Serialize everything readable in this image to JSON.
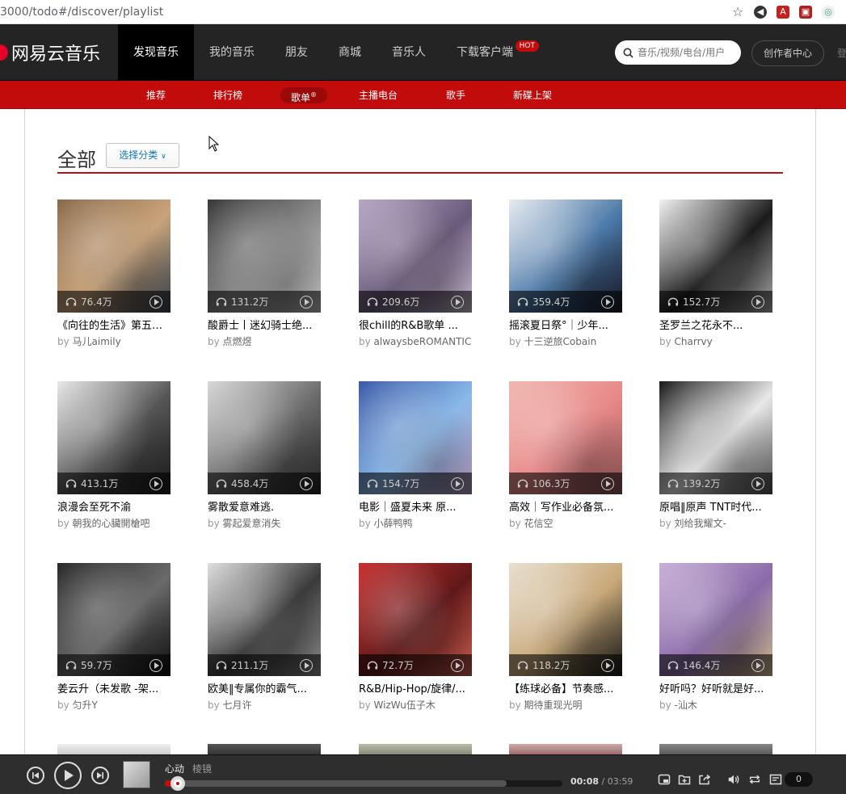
{
  "browser": {
    "url": "3000/todo#/discover/playlist"
  },
  "header": {
    "logo": "网易云音乐",
    "nav": [
      {
        "label": "发现音乐",
        "active": true
      },
      {
        "label": "我的音乐"
      },
      {
        "label": "朋友"
      },
      {
        "label": "商城"
      },
      {
        "label": "音乐人"
      },
      {
        "label": "下载客户端"
      }
    ],
    "hot_badge": "HOT",
    "search_placeholder": "音乐/视频/电台/用户",
    "creator_label": "创作者中心",
    "login_label": "登"
  },
  "subnav": [
    {
      "label": "推荐"
    },
    {
      "label": "排行榜"
    },
    {
      "label": "歌单",
      "active": true
    },
    {
      "label": "主播电台"
    },
    {
      "label": "歌手"
    },
    {
      "label": "新碟上架"
    }
  ],
  "page": {
    "heading": "全部",
    "select_label": "选择分类"
  },
  "author_prefix": "by",
  "playlists": [
    {
      "title": "《向往的生活》第五季...",
      "author": "马儿aimily",
      "plays": "76.4万",
      "colors": [
        "#8a6a4a",
        "#c9a37a",
        "#3e4a5a"
      ]
    },
    {
      "title": "酸爵士丨迷幻骑士绝...",
      "author": "点燃煜",
      "plays": "131.2万",
      "colors": [
        "#3a3a3a",
        "#8c8c8c",
        "#d0d0d0"
      ]
    },
    {
      "title": "很chill的R&B歌单 ...",
      "author": "alwaysbeROMANTIC",
      "plays": "209.6万",
      "colors": [
        "#b8a8c8",
        "#6a5a7a",
        "#e0d0e8"
      ]
    },
    {
      "title": "摇滚夏日祭°｜少年...",
      "author": "十三逆旅Cobain",
      "plays": "359.4万",
      "colors": [
        "#e8ecf0",
        "#4a78a8",
        "#1a1a2a"
      ]
    },
    {
      "title": "圣罗兰之花永不...",
      "author": "Charrvy",
      "plays": "152.7万",
      "colors": [
        "#f2f2f2",
        "#1a1a1a",
        "#c0c0c0"
      ]
    },
    {
      "title": "浪漫会至死不渝",
      "author": "朝我的心臟開槍吧",
      "plays": "413.1万",
      "colors": [
        "#e8e8e8",
        "#555555",
        "#1f1f1f"
      ]
    },
    {
      "title": "雾散爱意难逃.",
      "author": "雾起爱意消失",
      "plays": "458.4万",
      "colors": [
        "#d8d8d8",
        "#6a6a6a",
        "#2a2a2a"
      ]
    },
    {
      "title": "电影｜盛夏未来 原...",
      "author": "小薛鸭鸭",
      "plays": "154.7万",
      "colors": [
        "#3a5aa8",
        "#8ab8e8",
        "#c0a0c8"
      ]
    },
    {
      "title": "高效｜写作业必备氛...",
      "author": "花信空",
      "plays": "106.3万",
      "colors": [
        "#f0b8b0",
        "#e88888",
        "#9a5a5a"
      ]
    },
    {
      "title": "原唱‖原声 TNT时代...",
      "author": "刘给我耀文-",
      "plays": "139.2万",
      "colors": [
        "#1a1a1a",
        "#e8e8e8",
        "#5a5a5a"
      ]
    },
    {
      "title": "姜云升（未发歌 -架...",
      "author": "匀升Y",
      "plays": "59.7万",
      "colors": [
        "#2a2a2a",
        "#6a6a6a",
        "#101010"
      ]
    },
    {
      "title": "欧美‖专属你的霸气...",
      "author": "七月许",
      "plays": "211.1万",
      "colors": [
        "#e0e0e0",
        "#3a3a3a",
        "#9a9a9a"
      ]
    },
    {
      "title": "R&B/Hip-Hop/旋律/...",
      "author": "WizWu伍子木",
      "plays": "72.7万",
      "colors": [
        "#c83030",
        "#601818",
        "#e86a5a"
      ]
    },
    {
      "title": "【练球必备】节奏感...",
      "author": "期待重现光明",
      "plays": "118.2万",
      "colors": [
        "#e8e0d0",
        "#c8a878",
        "#1a1a1a"
      ]
    },
    {
      "title": "好听吗？好听就是好...",
      "author": "-汕木",
      "plays": "146.4万",
      "colors": [
        "#c8b0d8",
        "#8a6aa8",
        "#e8d0a0"
      ]
    }
  ],
  "player": {
    "song": "心动",
    "artist": "棱镜",
    "current_time": "00:08",
    "separator": "/",
    "total_time": "03:59",
    "progress": 0.033,
    "buffered": 0.86,
    "playlist_count": "0"
  }
}
